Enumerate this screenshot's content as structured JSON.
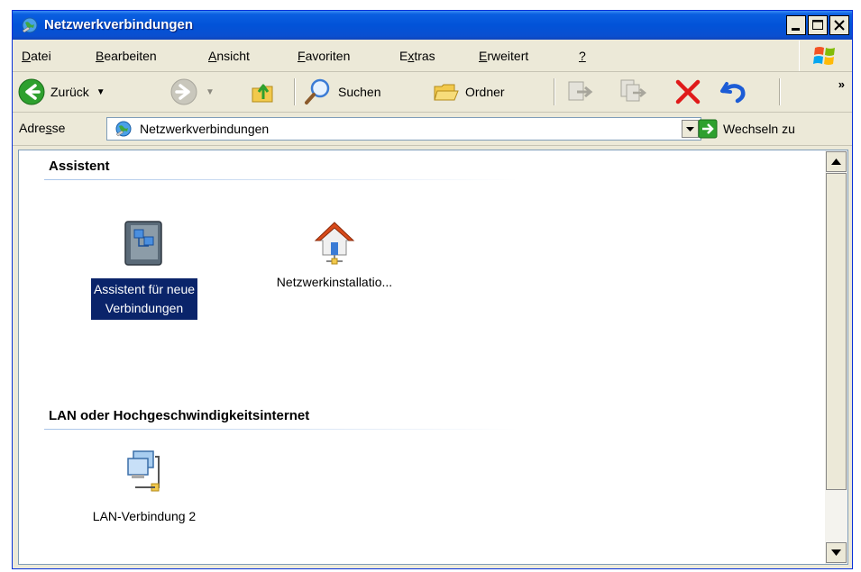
{
  "window": {
    "title": "Netzwerkverbindungen"
  },
  "menu": {
    "items": [
      {
        "pre": "",
        "u": "D",
        "post": "atei"
      },
      {
        "pre": "",
        "u": "B",
        "post": "earbeiten"
      },
      {
        "pre": "",
        "u": "A",
        "post": "nsicht"
      },
      {
        "pre": "",
        "u": "F",
        "post": "avoriten"
      },
      {
        "pre": "E",
        "u": "x",
        "post": "tras"
      },
      {
        "pre": "",
        "u": "E",
        "post": "rweitert"
      },
      {
        "pre": "",
        "u": "?",
        "post": ""
      }
    ]
  },
  "toolbar": {
    "back_label": "Zurück",
    "search_label": "Suchen",
    "folders_label": "Ordner",
    "more": "»"
  },
  "address": {
    "label_pre": "Adre",
    "label_u": "s",
    "label_post": "se",
    "value": "Netzwerkverbindungen",
    "go_label": "Wechseln zu"
  },
  "groups": {
    "assistant": {
      "title": "Assistent",
      "items": [
        {
          "line1": "Assistent für neue",
          "line2": "Verbindungen",
          "selected": true
        },
        {
          "line1": "Netzwerkinstallatio...",
          "line2": "",
          "selected": false
        }
      ]
    },
    "lan": {
      "title": "LAN oder Hochgeschwindigkeitsinternet",
      "items": [
        {
          "line1": "LAN-Verbindung 2",
          "line2": "",
          "selected": false
        }
      ]
    }
  },
  "colors": {
    "titlebar": "#0253d8",
    "selection": "#0a246a",
    "back_arrow": "#2ea02e",
    "delete_x": "#e01a1a",
    "undo": "#1c5cd6"
  }
}
